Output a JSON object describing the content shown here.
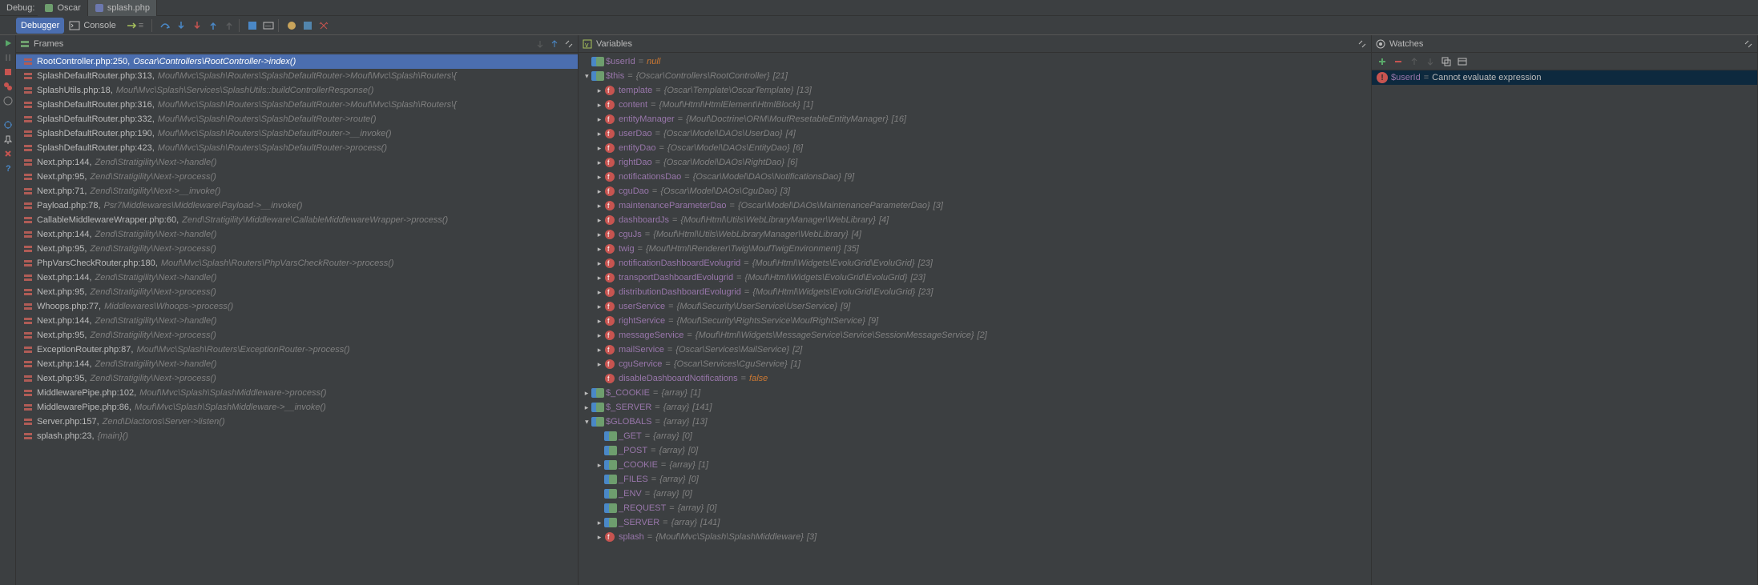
{
  "topbar": {
    "label": "Debug:",
    "tabs": [
      {
        "icon": "oscar",
        "label": "Oscar",
        "active": false
      },
      {
        "icon": "php",
        "label": "splash.php",
        "active": true
      }
    ]
  },
  "toolbar": {
    "debugger_label": "Debugger",
    "console_label": "Console"
  },
  "frames": {
    "title": "Frames",
    "items": [
      {
        "loc": "RootController.php:250",
        "call": "Oscar\\Controllers\\RootController->index()",
        "sel": true
      },
      {
        "loc": "SplashDefaultRouter.php:313",
        "call": "Mouf\\Mvc\\Splash\\Routers\\SplashDefaultRouter->Mouf\\Mvc\\Splash\\Routers\\{"
      },
      {
        "loc": "SplashUtils.php:18",
        "call": "Mouf\\Mvc\\Splash\\Services\\SplashUtils::buildControllerResponse()"
      },
      {
        "loc": "SplashDefaultRouter.php:316",
        "call": "Mouf\\Mvc\\Splash\\Routers\\SplashDefaultRouter->Mouf\\Mvc\\Splash\\Routers\\{"
      },
      {
        "loc": "SplashDefaultRouter.php:332",
        "call": "Mouf\\Mvc\\Splash\\Routers\\SplashDefaultRouter->route()"
      },
      {
        "loc": "SplashDefaultRouter.php:190",
        "call": "Mouf\\Mvc\\Splash\\Routers\\SplashDefaultRouter->__invoke()"
      },
      {
        "loc": "SplashDefaultRouter.php:423",
        "call": "Mouf\\Mvc\\Splash\\Routers\\SplashDefaultRouter->process()"
      },
      {
        "loc": "Next.php:144",
        "call": "Zend\\Stratigility\\Next->handle()"
      },
      {
        "loc": "Next.php:95",
        "call": "Zend\\Stratigility\\Next->process()"
      },
      {
        "loc": "Next.php:71",
        "call": "Zend\\Stratigility\\Next->__invoke()"
      },
      {
        "loc": "Payload.php:78",
        "call": "Psr7Middlewares\\Middleware\\Payload->__invoke()"
      },
      {
        "loc": "CallableMiddlewareWrapper.php:60",
        "call": "Zend\\Stratigility\\Middleware\\CallableMiddlewareWrapper->process()"
      },
      {
        "loc": "Next.php:144",
        "call": "Zend\\Stratigility\\Next->handle()"
      },
      {
        "loc": "Next.php:95",
        "call": "Zend\\Stratigility\\Next->process()"
      },
      {
        "loc": "PhpVarsCheckRouter.php:180",
        "call": "Mouf\\Mvc\\Splash\\Routers\\PhpVarsCheckRouter->process()"
      },
      {
        "loc": "Next.php:144",
        "call": "Zend\\Stratigility\\Next->handle()"
      },
      {
        "loc": "Next.php:95",
        "call": "Zend\\Stratigility\\Next->process()"
      },
      {
        "loc": "Whoops.php:77",
        "call": "Middlewares\\Whoops->process()"
      },
      {
        "loc": "Next.php:144",
        "call": "Zend\\Stratigility\\Next->handle()"
      },
      {
        "loc": "Next.php:95",
        "call": "Zend\\Stratigility\\Next->process()"
      },
      {
        "loc": "ExceptionRouter.php:87",
        "call": "Mouf\\Mvc\\Splash\\Routers\\ExceptionRouter->process()"
      },
      {
        "loc": "Next.php:144",
        "call": "Zend\\Stratigility\\Next->handle()"
      },
      {
        "loc": "Next.php:95",
        "call": "Zend\\Stratigility\\Next->process()"
      },
      {
        "loc": "MiddlewarePipe.php:102",
        "call": "Mouf\\Mvc\\Splash\\SplashMiddleware->process()"
      },
      {
        "loc": "MiddlewarePipe.php:86",
        "call": "Mouf\\Mvc\\Splash\\SplashMiddleware->__invoke()"
      },
      {
        "loc": "Server.php:157",
        "call": "Zend\\Diactoros\\Server->listen()"
      },
      {
        "loc": "splash.php:23",
        "call": "{main}()"
      }
    ]
  },
  "variables": {
    "title": "Variables",
    "rows": [
      {
        "depth": 0,
        "arrow": "",
        "name": "$userId",
        "type": "",
        "val": "null",
        "vclass": "val-null"
      },
      {
        "depth": 0,
        "arrow": "down",
        "name": "$this",
        "type": "{Oscar\\Controllers\\RootController}",
        "count": "[21]"
      },
      {
        "depth": 1,
        "arrow": "right",
        "name": "template",
        "type": "{Oscar\\Template\\OscarTemplate}",
        "count": "[13]"
      },
      {
        "depth": 1,
        "arrow": "right",
        "name": "content",
        "type": "{Mouf\\Html\\HtmlElement\\HtmlBlock}",
        "count": "[1]"
      },
      {
        "depth": 1,
        "arrow": "right",
        "name": "entityManager",
        "type": "{Mouf\\Doctrine\\ORM\\MoufResetableEntityManager}",
        "count": "[16]"
      },
      {
        "depth": 1,
        "arrow": "right",
        "name": "userDao",
        "type": "{Oscar\\Model\\DAOs\\UserDao}",
        "count": "[4]"
      },
      {
        "depth": 1,
        "arrow": "right",
        "name": "entityDao",
        "type": "{Oscar\\Model\\DAOs\\EntityDao}",
        "count": "[6]"
      },
      {
        "depth": 1,
        "arrow": "right",
        "name": "rightDao",
        "type": "{Oscar\\Model\\DAOs\\RightDao}",
        "count": "[6]"
      },
      {
        "depth": 1,
        "arrow": "right",
        "name": "notificationsDao",
        "type": "{Oscar\\Model\\DAOs\\NotificationsDao}",
        "count": "[9]"
      },
      {
        "depth": 1,
        "arrow": "right",
        "name": "cguDao",
        "type": "{Oscar\\Model\\DAOs\\CguDao}",
        "count": "[3]"
      },
      {
        "depth": 1,
        "arrow": "right",
        "name": "maintenanceParameterDao",
        "type": "{Oscar\\Model\\DAOs\\MaintenanceParameterDao}",
        "count": "[3]"
      },
      {
        "depth": 1,
        "arrow": "right",
        "name": "dashboardJs",
        "type": "{Mouf\\Html\\Utils\\WebLibraryManager\\WebLibrary}",
        "count": "[4]"
      },
      {
        "depth": 1,
        "arrow": "right",
        "name": "cguJs",
        "type": "{Mouf\\Html\\Utils\\WebLibraryManager\\WebLibrary}",
        "count": "[4]"
      },
      {
        "depth": 1,
        "arrow": "right",
        "name": "twig",
        "type": "{Mouf\\Html\\Renderer\\Twig\\MoufTwigEnvironment}",
        "count": "[35]"
      },
      {
        "depth": 1,
        "arrow": "right",
        "name": "notificationDashboardEvolugrid",
        "type": "{Mouf\\Html\\Widgets\\EvoluGrid\\EvoluGrid}",
        "count": "[23]"
      },
      {
        "depth": 1,
        "arrow": "right",
        "name": "transportDashboardEvolugrid",
        "type": "{Mouf\\Html\\Widgets\\EvoluGrid\\EvoluGrid}",
        "count": "[23]"
      },
      {
        "depth": 1,
        "arrow": "right",
        "name": "distributionDashboardEvolugrid",
        "type": "{Mouf\\Html\\Widgets\\EvoluGrid\\EvoluGrid}",
        "count": "[23]"
      },
      {
        "depth": 1,
        "arrow": "right",
        "name": "userService",
        "type": "{Mouf\\Security\\UserService\\UserService}",
        "count": "[9]"
      },
      {
        "depth": 1,
        "arrow": "right",
        "name": "rightService",
        "type": "{Mouf\\Security\\RightsService\\MoufRightService}",
        "count": "[9]"
      },
      {
        "depth": 1,
        "arrow": "right",
        "name": "messageService",
        "type": "{Mouf\\Html\\Widgets\\MessageService\\Service\\SessionMessageService}",
        "count": "[2]"
      },
      {
        "depth": 1,
        "arrow": "right",
        "name": "mailService",
        "type": "{Oscar\\Services\\MailService}",
        "count": "[2]"
      },
      {
        "depth": 1,
        "arrow": "right",
        "name": "cguService",
        "type": "{Oscar\\Services\\CguService}",
        "count": "[1]"
      },
      {
        "depth": 1,
        "arrow": "",
        "name": "disableDashboardNotifications",
        "type": "",
        "val": "false",
        "vclass": "val-false"
      },
      {
        "depth": 0,
        "arrow": "right",
        "name": "$_COOKIE",
        "type": "{array}",
        "count": "[1]"
      },
      {
        "depth": 0,
        "arrow": "right",
        "name": "$_SERVER",
        "type": "{array}",
        "count": "[141]"
      },
      {
        "depth": 0,
        "arrow": "down",
        "name": "$GLOBALS",
        "type": "{array}",
        "count": "[13]"
      },
      {
        "depth": 1,
        "arrow": "",
        "name": "_GET",
        "type": "{array}",
        "count": "[0]"
      },
      {
        "depth": 1,
        "arrow": "",
        "name": "_POST",
        "type": "{array}",
        "count": "[0]"
      },
      {
        "depth": 1,
        "arrow": "right",
        "name": "_COOKIE",
        "type": "{array}",
        "count": "[1]"
      },
      {
        "depth": 1,
        "arrow": "",
        "name": "_FILES",
        "type": "{array}",
        "count": "[0]"
      },
      {
        "depth": 1,
        "arrow": "",
        "name": "_ENV",
        "type": "{array}",
        "count": "[0]"
      },
      {
        "depth": 1,
        "arrow": "",
        "name": "_REQUEST",
        "type": "{array}",
        "count": "[0]"
      },
      {
        "depth": 1,
        "arrow": "right",
        "name": "_SERVER",
        "type": "{array}",
        "count": "[141]"
      },
      {
        "depth": 1,
        "arrow": "right",
        "name": "splash",
        "type": "{Mouf\\Mvc\\Splash\\SplashMiddleware}",
        "count": "[3]"
      }
    ]
  },
  "watches": {
    "title": "Watches",
    "items": [
      {
        "expr": "$userId",
        "result": "Cannot evaluate expression"
      }
    ]
  }
}
